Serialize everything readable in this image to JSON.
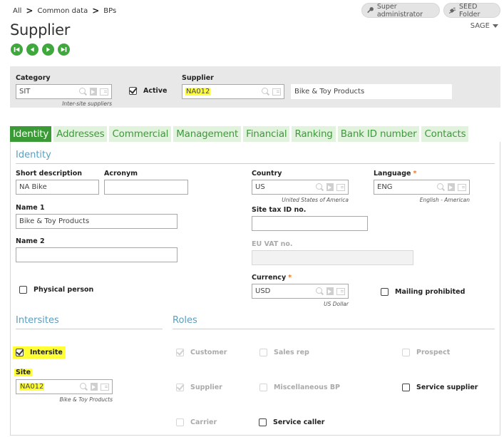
{
  "breadcrumb": [
    "All",
    "Common data",
    "BPs"
  ],
  "page_title": "Supplier",
  "nav_buttons": [
    "first-record",
    "previous-record",
    "next-record",
    "last-record"
  ],
  "top_right": {
    "user_label": "Super administrator",
    "folder_label": "SEED Folder",
    "company_menu": "SAGE"
  },
  "header": {
    "category_label": "Category",
    "category_value": "SIT",
    "category_desc": "Inter-site suppliers",
    "active_label": "Active",
    "active_checked": true,
    "supplier_label": "Supplier",
    "supplier_value": "NA012",
    "supplier_name": "Bike & Toy Products"
  },
  "tabs": [
    "Identity",
    "Addresses",
    "Commercial",
    "Management",
    "Financial",
    "Ranking",
    "Bank ID number",
    "Contacts"
  ],
  "active_tab": "Identity",
  "identity": {
    "section_title": "Identity",
    "short_description_label": "Short description",
    "short_description_value": "NA Bike",
    "acronym_label": "Acronym",
    "acronym_value": "",
    "name1_label": "Name 1",
    "name1_value": "Bike & Toy Products",
    "name2_label": "Name 2",
    "name2_value": "",
    "physical_person_label": "Physical person",
    "country_label": "Country",
    "country_value": "US",
    "country_desc": "United States of America",
    "language_label": "Language",
    "language_value": "ENG",
    "language_desc": "English - American",
    "site_tax_label": "Site tax ID no.",
    "site_tax_value": "",
    "eu_vat_label": "EU VAT no.",
    "eu_vat_value": "",
    "currency_label": "Currency",
    "currency_value": "USD",
    "currency_desc": "US Dollar",
    "mailing_prohibited_label": "Mailing prohibited",
    "required_mark": "*"
  },
  "intersites": {
    "section_title": "Intersites",
    "intersite_label": "Intersite",
    "intersite_checked": true,
    "site_label": "Site",
    "site_value": "NA012",
    "site_desc": "Bike & Toy Products"
  },
  "roles": {
    "section_title": "Roles",
    "customer": "Customer",
    "sales_rep": "Sales rep",
    "prospect": "Prospect",
    "supplier": "Supplier",
    "misc_bp": "Miscellaneous BP",
    "service_supplier": "Service supplier",
    "carrier": "Carrier",
    "service_caller": "Service caller"
  },
  "colors": {
    "accent_green": "#3a9a36",
    "tab_inactive_bg": "#e2f3dd",
    "section_blue": "#5a9ec0",
    "highlight_yellow": "#ffff33",
    "required_orange": "#e07a2e"
  }
}
